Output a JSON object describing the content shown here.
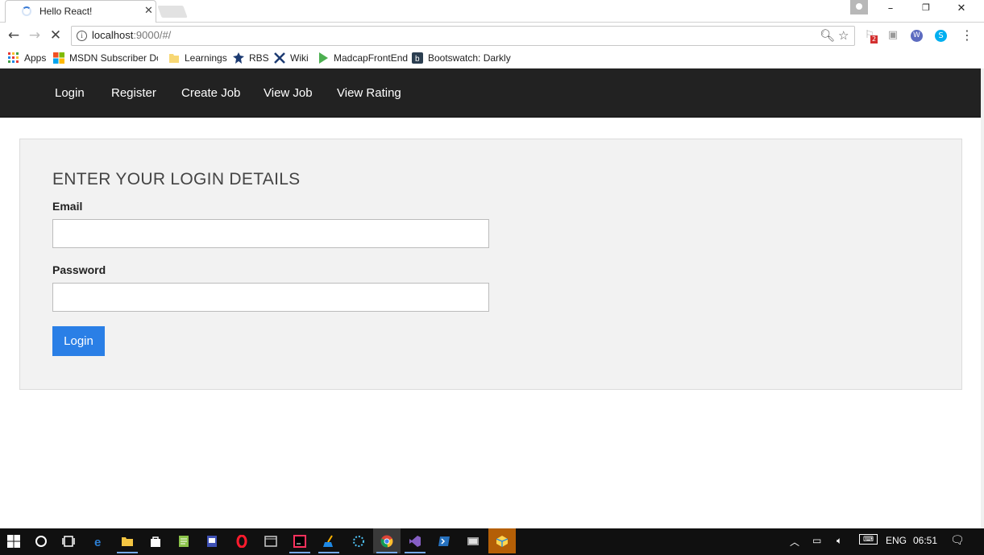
{
  "browser": {
    "tab_title": "Hello React!",
    "tab_close": "✕",
    "window_controls": {
      "minimize": "–",
      "restore": "❐",
      "close": "✕"
    },
    "url_host": "localhost",
    "url_rest": ":9000/#/",
    "extension_badge": "2"
  },
  "bookmarks": [
    {
      "label": "Apps",
      "icon": "apps-grid-icon"
    },
    {
      "label": "MSDN Subscriber Do",
      "icon": "windows-logo-icon"
    },
    {
      "label": "Learnings",
      "icon": "folder-icon"
    },
    {
      "label": "RBS",
      "icon": "rbs-logo-icon"
    },
    {
      "label": "Wiki",
      "icon": "wiki-icon"
    },
    {
      "label": "MadcapFrontEnd",
      "icon": "play-triangle-icon"
    },
    {
      "label": "Bootswatch: Darkly",
      "icon": "bootswatch-icon"
    }
  ],
  "nav": {
    "items": [
      "Login",
      "Register",
      "Create Job",
      "View Job",
      "View Rating"
    ]
  },
  "form": {
    "legend": "ENTER YOUR LOGIN DETAILS",
    "email_label": "Email",
    "email_value": "",
    "password_label": "Password",
    "password_value": "",
    "submit_label": "Login"
  },
  "taskbar": {
    "language": "ENG",
    "time": "06:51"
  },
  "colors": {
    "navbar_bg": "#222222",
    "primary_button": "#2a7fe6",
    "well_bg": "#f2f2f2"
  }
}
